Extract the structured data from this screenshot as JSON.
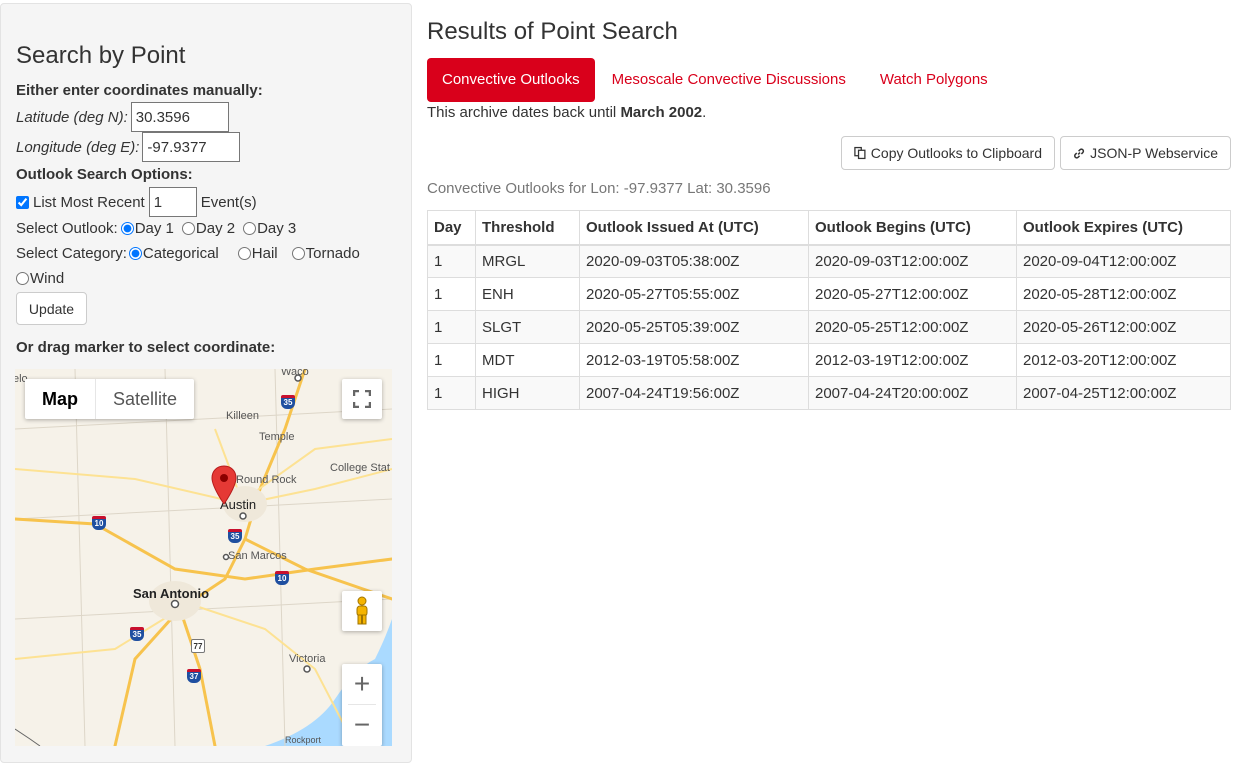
{
  "search": {
    "title": "Search by Point",
    "manual_heading": "Either enter coordinates manually:",
    "lat_label": "Latitude (deg N):",
    "lat_value": "30.3596",
    "lon_label": "Longitude (deg E):",
    "lon_value": "-97.9377",
    "options_heading": "Outlook Search Options:",
    "list_recent_label": "List Most Recent",
    "list_recent_value": "1",
    "events_label": "Event(s)",
    "select_outlook_label": "Select Outlook:",
    "outlooks": [
      "Day 1",
      "Day 2",
      "Day 3"
    ],
    "selected_outlook": "Day 1",
    "select_category_label": "Select Category:",
    "categories": [
      "Categorical",
      "Hail",
      "Tornado",
      "Wind"
    ],
    "selected_category": "Categorical",
    "update_label": "Update",
    "drag_heading": "Or drag marker to select coordinate:"
  },
  "map": {
    "type_map": "Map",
    "type_satellite": "Satellite",
    "cities": [
      "Waco",
      "Killeen",
      "Temple",
      "College Stat",
      "Round Rock",
      "Austin",
      "San Marcos",
      "San Antonio",
      "Victoria",
      "Rockport",
      "elo"
    ],
    "highways": [
      "35",
      "10",
      "35",
      "10",
      "35",
      "37",
      "77"
    ],
    "marker_color": "#e53935"
  },
  "results": {
    "title": "Results of Point Search",
    "tabs": [
      "Convective Outlooks",
      "Mesoscale Convective Discussions",
      "Watch Polygons"
    ],
    "archive_text": "This archive dates back until ",
    "archive_date": "March 2002",
    "archive_end": ".",
    "copy_button": "Copy Outlooks to Clipboard",
    "json_button": "JSON-P Webservice",
    "caption": "Convective Outlooks for Lon: -97.9377 Lat: 30.3596",
    "columns": [
      "Day",
      "Threshold",
      "Outlook Issued At (UTC)",
      "Outlook Begins (UTC)",
      "Outlook Expires (UTC)"
    ],
    "rows": [
      [
        "1",
        "MRGL",
        "2020-09-03T05:38:00Z",
        "2020-09-03T12:00:00Z",
        "2020-09-04T12:00:00Z"
      ],
      [
        "1",
        "ENH",
        "2020-05-27T05:55:00Z",
        "2020-05-27T12:00:00Z",
        "2020-05-28T12:00:00Z"
      ],
      [
        "1",
        "SLGT",
        "2020-05-25T05:39:00Z",
        "2020-05-25T12:00:00Z",
        "2020-05-26T12:00:00Z"
      ],
      [
        "1",
        "MDT",
        "2012-03-19T05:58:00Z",
        "2012-03-19T12:00:00Z",
        "2012-03-20T12:00:00Z"
      ],
      [
        "1",
        "HIGH",
        "2007-04-24T19:56:00Z",
        "2007-04-24T20:00:00Z",
        "2007-04-25T12:00:00Z"
      ]
    ]
  },
  "colors": {
    "accent": "#d9001b",
    "panel_bg": "#f5f5f5"
  }
}
